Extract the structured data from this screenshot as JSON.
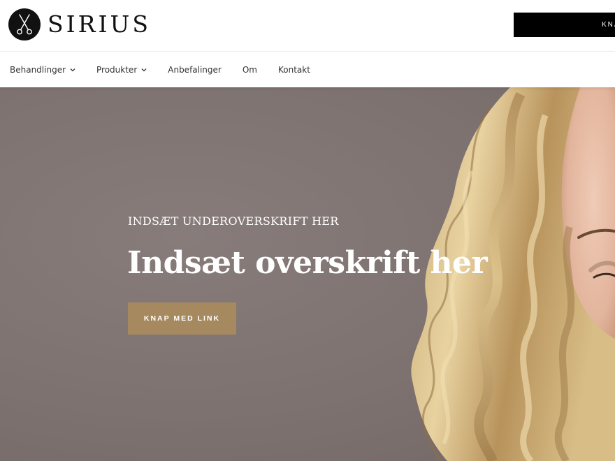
{
  "brand": {
    "name": "SIRIUS",
    "logo_icon": "scissors-icon"
  },
  "header": {
    "cta_label": "KNAP MED LINK"
  },
  "nav": {
    "items": [
      {
        "label": "Behandlinger",
        "has_dropdown": true
      },
      {
        "label": "Produkter",
        "has_dropdown": true
      },
      {
        "label": "Anbefalinger",
        "has_dropdown": false
      },
      {
        "label": "Om",
        "has_dropdown": false
      },
      {
        "label": "Kontakt",
        "has_dropdown": false
      }
    ]
  },
  "hero": {
    "subtitle": "INDSÆT UNDEROVERSKRIFT HER",
    "title": "Indsæt overskrift her",
    "button_label": "KNAP MED LINK",
    "image": "woman-with-blonde-wavy-hair"
  },
  "colors": {
    "accent": "#a6895f",
    "hero_background": "#7d7270",
    "header_button": "#000000",
    "text_dark": "#222222"
  }
}
